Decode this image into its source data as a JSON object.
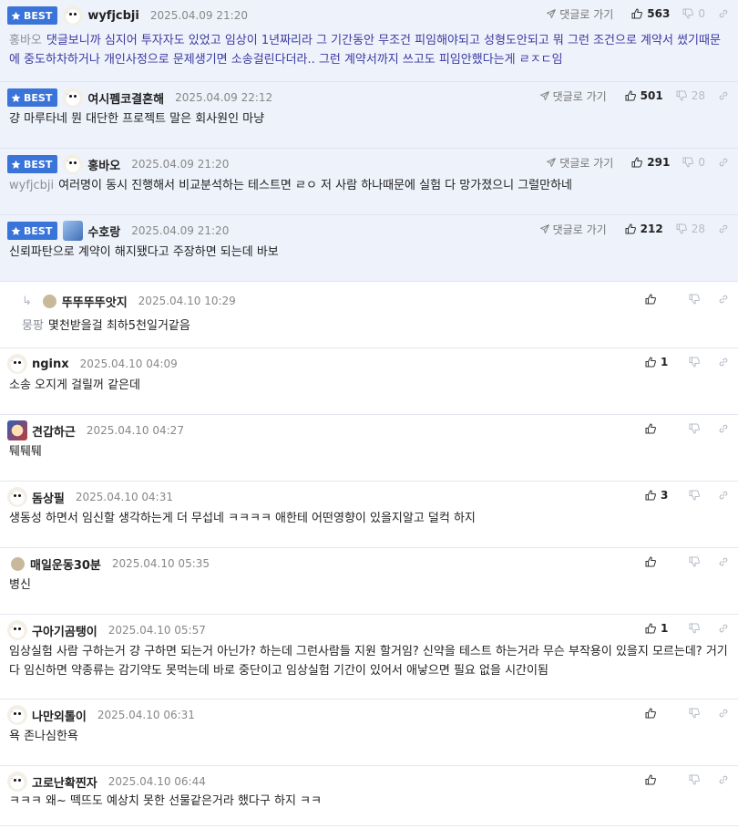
{
  "labels": {
    "best": "BEST",
    "goto_reply": "댓글로 가기"
  },
  "colors": {
    "best_bg": "#eef2fb",
    "badge": "#3b74d9"
  },
  "comments": [
    {
      "best": true,
      "avatar": "dog-icon",
      "nick": "wyfjcbji",
      "date": "2025.04.09 21:20",
      "likes": "563",
      "dislikes": "0",
      "mention": "홍바오",
      "text": "댓글보니까 심지어 투자자도 있었고 임상이 1년짜리라 그 기간동안 무조건 피임해야되고 성형도안되고 뭐 그런 조건으로 계약서 썼기때문에 중도하차하거나 개인사정으로 문제생기면 소송걸린다더라.. 그런 계약서까지 쓰고도 피임안했다는게 ㄹㅈㄷ임"
    },
    {
      "best": true,
      "avatar": "dog-icon",
      "nick": "여시펨코결혼해",
      "date": "2025.04.09 22:12",
      "likes": "501",
      "dislikes": "28",
      "mention": "",
      "text": "걍 마루타네 뭔 대단한 프로젝트 말은 회사원인 마냥"
    },
    {
      "best": true,
      "avatar": "dog-icon",
      "nick": "홍바오",
      "date": "2025.04.09 21:20",
      "likes": "291",
      "dislikes": "0",
      "mention": "wyfjcbji",
      "text": "여러명이 동시 진행해서 비교분석하는 테스트면 ㄹㅇ 저 사람 하나때문에 실험 다 망가졌으니 그럴만하네"
    },
    {
      "best": true,
      "avatar": "blue-icon",
      "nick": "수호랑",
      "date": "2025.04.09 21:20",
      "likes": "212",
      "dislikes": "28",
      "mention": "",
      "text": "신뢰파탄으로 계약이 해지됐다고 주장하면 되는데 바보"
    },
    {
      "best": false,
      "reply": true,
      "avatar": "dot-icon",
      "nick": "뚜뚜뚜뚜앗지",
      "date": "2025.04.10 10:29",
      "likes": "",
      "dislikes": "",
      "mention": "뭉팡",
      "text": "몇천받을걸 최하5천일거같음"
    },
    {
      "best": false,
      "avatar": "dog-icon",
      "nick": "nginx",
      "date": "2025.04.10 04:09",
      "likes": "1",
      "dislikes": "",
      "mention": "",
      "text": "소송 오지게 걸릴꺼 같은데"
    },
    {
      "best": false,
      "avatar": "face-icon",
      "nick": "견갑하근",
      "date": "2025.04.10 04:27",
      "likes": "",
      "dislikes": "",
      "mention": "",
      "text": "퉤퉤퉤"
    },
    {
      "best": false,
      "avatar": "dog-icon",
      "nick": "돔상필",
      "date": "2025.04.10 04:31",
      "likes": "3",
      "dislikes": "",
      "mention": "",
      "text": "생동성 하면서 임신할 생각하는게 더 무섭네 ㅋㅋㅋㅋ 애한테 어떤영향이 있을지알고 덜컥 하지"
    },
    {
      "best": false,
      "avatar": "dot-icon",
      "nick": "매일운동30분",
      "date": "2025.04.10 05:35",
      "likes": "",
      "dislikes": "",
      "mention": "",
      "text": "병신"
    },
    {
      "best": false,
      "avatar": "dog-icon",
      "nick": "구아기곰탱이",
      "date": "2025.04.10 05:57",
      "likes": "1",
      "dislikes": "",
      "mention": "",
      "text": "임상실험 사람 구하는거 걍 구하면 되는거 아닌가? 하는데 그런사람들 지원 할거임? 신약을 테스트 하는거라 무슨 부작용이 있을지 모르는데? 거기다 임신하면 약종류는 감기약도 못먹는데 바로 중단이고 임상실험 기간이 있어서 애낳으면 필요 없을 시간이됨"
    },
    {
      "best": false,
      "avatar": "dog-icon",
      "nick": "나만외톨이",
      "date": "2025.04.10 06:31",
      "likes": "",
      "dislikes": "",
      "mention": "",
      "text": "욕 존나심한욕"
    },
    {
      "best": false,
      "avatar": "dog-icon",
      "nick": "고로난확찐자",
      "date": "2025.04.10 06:44",
      "likes": "",
      "dislikes": "",
      "mention": "",
      "text": "ㅋㅋㅋ 왜~ 떽뜨도 예상치 못한 선물같은거라 했다구 하지 ㅋㅋ"
    }
  ]
}
